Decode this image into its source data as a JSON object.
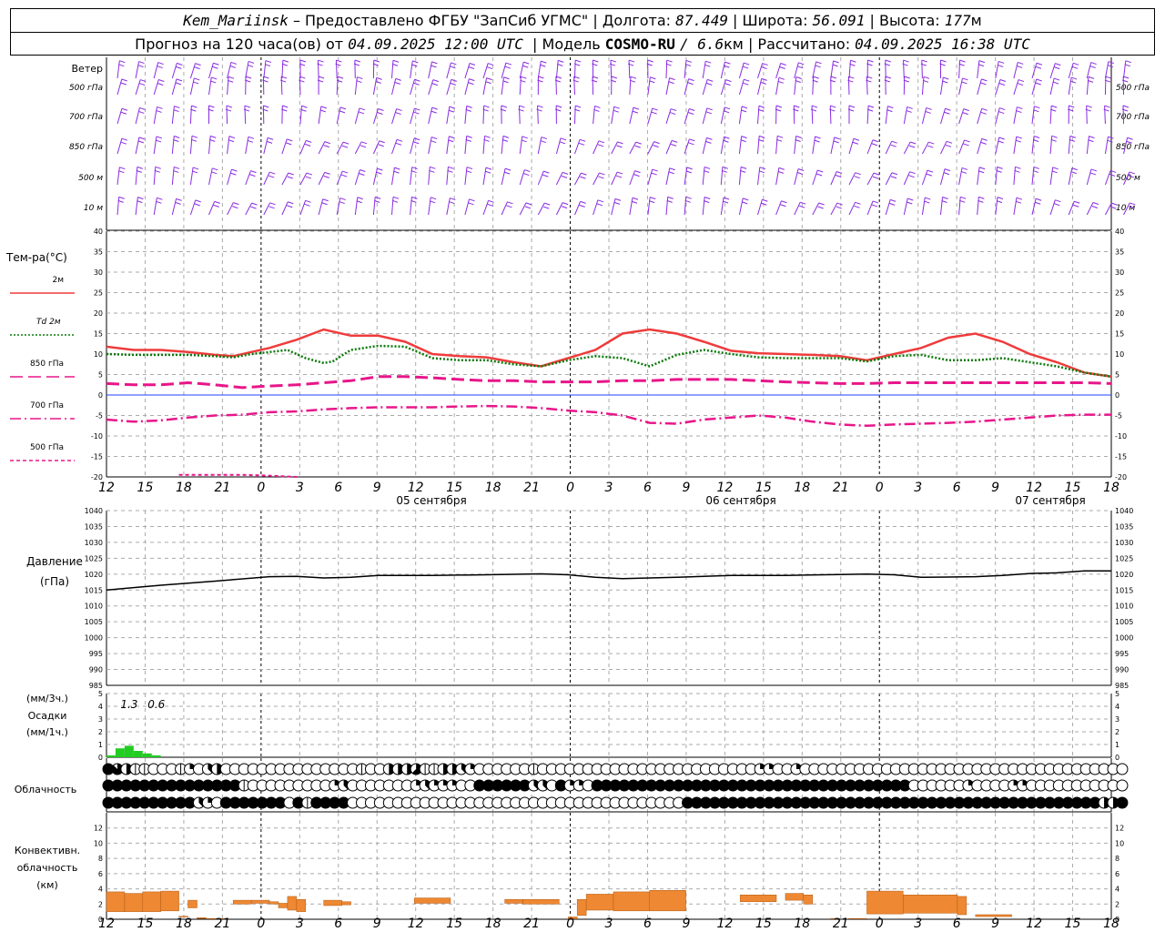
{
  "header": {
    "station": "Kem_Mariinsk",
    "provider": "– Предоставлено ФГБУ \"ЗапСиб УГМС\"",
    "lon_label": "| Долгота:",
    "lon": "87.449",
    "lat_label": "| Широта:",
    "lat": "56.091",
    "alt_label": "| Высота:",
    "alt": "177",
    "alt_unit": "м",
    "forecast_label": "Прогноз на 120 часа(ов) от",
    "forecast_start": "04.09.2025 12:00 UTC",
    "model_label": "| Модель",
    "model": "COSMO-RU",
    "model_res": "/ 6.6",
    "model_res_unit": "км",
    "calc_label": "| Рассчитано:",
    "calc_time": "04.09.2025 16:38 UTC"
  },
  "axis": {
    "hour_ticks": [
      "12",
      "15",
      "18",
      "21",
      "0",
      "3",
      "6",
      "9",
      "12",
      "15",
      "18",
      "21",
      "0",
      "3",
      "6",
      "9",
      "12",
      "15",
      "18",
      "21",
      "0",
      "3",
      "6",
      "9",
      "12",
      "15",
      "18"
    ],
    "day_labels": [
      "05 сентября",
      "06 сентября",
      "07 сентября"
    ]
  },
  "wind": {
    "title": "Ветер",
    "levels": [
      "500 гПа",
      "700 гПа",
      "850 гПа",
      "500 м",
      "10  м"
    ],
    "color": "#8a2be2"
  },
  "chart_data": [
    {
      "type": "line",
      "panel": "temperature",
      "title": "Тем-ра(°C)",
      "ylim": [
        -20,
        40
      ],
      "ticks": [
        -20,
        -15,
        -10,
        -5,
        0,
        5,
        10,
        15,
        20,
        25,
        30,
        35,
        40
      ],
      "series": [
        {
          "name": "2м",
          "color": "#ef3b3b",
          "style": "solid",
          "points": [
            [
              0,
              11.8
            ],
            [
              3,
              11
            ],
            [
              6,
              11
            ],
            [
              9,
              10.5
            ],
            [
              12,
              9.8
            ],
            [
              14,
              9.5
            ],
            [
              16,
              10.5
            ],
            [
              18,
              11.5
            ],
            [
              21,
              13.5
            ],
            [
              24,
              16
            ],
            [
              27,
              14.5
            ],
            [
              30,
              14.5
            ],
            [
              33,
              13
            ],
            [
              36,
              10
            ],
            [
              39,
              9.5
            ],
            [
              42,
              9.2
            ],
            [
              45,
              8
            ],
            [
              48,
              7
            ],
            [
              51,
              9
            ],
            [
              54,
              11
            ],
            [
              57,
              15
            ],
            [
              60,
              16
            ],
            [
              63,
              15
            ],
            [
              66,
              13
            ],
            [
              69,
              10.8
            ],
            [
              72,
              10.2
            ],
            [
              75,
              10
            ],
            [
              78,
              9.8
            ],
            [
              81,
              9.5
            ],
            [
              84,
              8.5
            ],
            [
              87,
              10
            ],
            [
              90,
              11.5
            ],
            [
              93,
              14
            ],
            [
              96,
              15
            ],
            [
              99,
              13
            ],
            [
              102,
              10
            ],
            [
              105,
              8
            ],
            [
              108,
              5.5
            ],
            [
              111,
              4.5
            ]
          ]
        },
        {
          "name": "Td  2м",
          "color": "#0a7a0a",
          "style": "dotted",
          "points": [
            [
              0,
              10
            ],
            [
              3,
              9.8
            ],
            [
              6,
              9.8
            ],
            [
              9,
              9.8
            ],
            [
              12,
              9.5
            ],
            [
              14,
              9.2
            ],
            [
              16,
              10
            ],
            [
              18,
              10.5
            ],
            [
              20,
              11
            ],
            [
              22,
              9
            ],
            [
              24,
              7.8
            ],
            [
              25,
              8.2
            ],
            [
              27,
              11
            ],
            [
              30,
              12
            ],
            [
              33,
              11.8
            ],
            [
              36,
              9
            ],
            [
              39,
              8.5
            ],
            [
              42,
              8.5
            ],
            [
              45,
              7.5
            ],
            [
              48,
              7
            ],
            [
              51,
              8.5
            ],
            [
              54,
              9.5
            ],
            [
              57,
              9
            ],
            [
              60,
              7
            ],
            [
              63,
              9.8
            ],
            [
              66,
              11
            ],
            [
              69,
              10
            ],
            [
              72,
              9.2
            ],
            [
              75,
              9
            ],
            [
              78,
              9
            ],
            [
              81,
              9
            ],
            [
              84,
              8.2
            ],
            [
              87,
              9.5
            ],
            [
              90,
              9.8
            ],
            [
              93,
              8.5
            ],
            [
              96,
              8.5
            ],
            [
              99,
              9
            ],
            [
              102,
              8
            ],
            [
              105,
              7
            ],
            [
              108,
              5.5
            ],
            [
              111,
              4.5
            ]
          ]
        },
        {
          "name": "850 гПа",
          "color": "#e8168a",
          "style": "longdash",
          "points": [
            [
              0,
              2.8
            ],
            [
              3,
              2.5
            ],
            [
              6,
              2.5
            ],
            [
              9,
              3
            ],
            [
              12,
              2.5
            ],
            [
              15,
              1.8
            ],
            [
              18,
              2.2
            ],
            [
              21,
              2.5
            ],
            [
              24,
              3
            ],
            [
              27,
              3.5
            ],
            [
              30,
              4.5
            ],
            [
              33,
              4.5
            ],
            [
              36,
              4.2
            ],
            [
              39,
              3.8
            ],
            [
              42,
              3.5
            ],
            [
              45,
              3.5
            ],
            [
              48,
              3.2
            ],
            [
              51,
              3.2
            ],
            [
              54,
              3.2
            ],
            [
              57,
              3.5
            ],
            [
              60,
              3.5
            ],
            [
              63,
              3.8
            ],
            [
              66,
              3.8
            ],
            [
              69,
              3.8
            ],
            [
              72,
              3.5
            ],
            [
              75,
              3.2
            ],
            [
              78,
              3
            ],
            [
              81,
              2.8
            ],
            [
              84,
              2.8
            ],
            [
              87,
              3
            ],
            [
              90,
              3
            ],
            [
              93,
              3
            ],
            [
              96,
              3
            ],
            [
              99,
              3
            ],
            [
              102,
              3
            ],
            [
              105,
              3
            ],
            [
              108,
              3
            ],
            [
              111,
              2.8
            ]
          ]
        },
        {
          "name": "700 гПа",
          "color": "#e8168a",
          "style": "dashdot",
          "points": [
            [
              0,
              -6
            ],
            [
              3,
              -6.5
            ],
            [
              6,
              -6.2
            ],
            [
              9,
              -5.5
            ],
            [
              12,
              -5
            ],
            [
              15,
              -4.8
            ],
            [
              18,
              -4.2
            ],
            [
              21,
              -4
            ],
            [
              24,
              -3.5
            ],
            [
              27,
              -3.2
            ],
            [
              30,
              -3
            ],
            [
              33,
              -3
            ],
            [
              36,
              -3
            ],
            [
              39,
              -2.8
            ],
            [
              42,
              -2.7
            ],
            [
              45,
              -2.8
            ],
            [
              48,
              -3.2
            ],
            [
              51,
              -3.8
            ],
            [
              54,
              -4.2
            ],
            [
              57,
              -5
            ],
            [
              60,
              -6.8
            ],
            [
              63,
              -7
            ],
            [
              66,
              -6
            ],
            [
              69,
              -5.5
            ],
            [
              72,
              -5
            ],
            [
              75,
              -5.5
            ],
            [
              78,
              -6.5
            ],
            [
              81,
              -7.2
            ],
            [
              84,
              -7.5
            ],
            [
              87,
              -7.2
            ],
            [
              90,
              -7
            ],
            [
              93,
              -6.8
            ],
            [
              96,
              -6.5
            ],
            [
              99,
              -6
            ],
            [
              102,
              -5.5
            ],
            [
              105,
              -5
            ],
            [
              108,
              -4.8
            ],
            [
              111,
              -4.8
            ]
          ]
        },
        {
          "name": "500 гПа",
          "color": "#e8168a",
          "style": "dashed",
          "points": [
            [
              8,
              -19.5
            ],
            [
              12,
              -19.5
            ],
            [
              15,
              -19.5
            ],
            [
              18,
              -19.7
            ],
            [
              21,
              -20
            ]
          ]
        }
      ]
    },
    {
      "type": "line",
      "panel": "pressure",
      "title": "Давление",
      "ylabel": "(гПа)",
      "ylim": [
        985,
        1040
      ],
      "ticks": [
        985,
        990,
        995,
        1000,
        1005,
        1010,
        1015,
        1020,
        1025,
        1030,
        1035,
        1040
      ],
      "series": [
        {
          "name": "",
          "color": "#000000",
          "points": [
            [
              0,
              1015
            ],
            [
              6,
              1016.5
            ],
            [
              12,
              1017.8
            ],
            [
              18,
              1019.2
            ],
            [
              21,
              1019.3
            ],
            [
              24,
              1018.8
            ],
            [
              27,
              1019
            ],
            [
              30,
              1019.6
            ],
            [
              36,
              1019.6
            ],
            [
              42,
              1019.8
            ],
            [
              48,
              1020.1
            ],
            [
              51,
              1019.8
            ],
            [
              54,
              1019
            ],
            [
              57,
              1018.6
            ],
            [
              60,
              1018.8
            ],
            [
              63,
              1019
            ],
            [
              69,
              1019.6
            ],
            [
              75,
              1019.6
            ],
            [
              81,
              1019.9
            ],
            [
              84,
              1020
            ],
            [
              87,
              1019.8
            ],
            [
              90,
              1019
            ],
            [
              93,
              1019.1
            ],
            [
              96,
              1019.2
            ],
            [
              99,
              1019.6
            ],
            [
              102,
              1020.2
            ],
            [
              105,
              1020.4
            ],
            [
              108,
              1021
            ],
            [
              111,
              1021
            ]
          ]
        }
      ]
    },
    {
      "type": "bar",
      "panel": "precipitation",
      "title": "Осадки",
      "ylabel_top": "(мм/3ч.)",
      "ylabel_bottom": "(мм/1ч.)",
      "ylim": [
        0,
        5
      ],
      "ticks": [
        0,
        1,
        2,
        3,
        4,
        5
      ],
      "color": "#22cc22",
      "annotations": [
        {
          "x": 1.5,
          "text": "1.3"
        },
        {
          "x": 4.5,
          "text": "0.6"
        }
      ],
      "bars": [
        [
          1,
          0.15
        ],
        [
          2,
          0.7
        ],
        [
          3,
          0.9
        ],
        [
          4,
          0.5
        ],
        [
          5,
          0.3
        ],
        [
          6,
          0.15
        ]
      ]
    },
    {
      "type": "bar",
      "panel": "convective_cloud",
      "title": "Конвективн.",
      "ylabel": "облачность",
      "ylabel2": "(км)",
      "ylim": [
        0,
        14
      ],
      "ticks": [
        0,
        2,
        4,
        6,
        8,
        10,
        12
      ],
      "color": "#ee8833",
      "bars": [
        [
          0,
          2,
          1,
          3.6
        ],
        [
          2,
          4,
          1,
          3.4
        ],
        [
          4,
          6,
          1,
          3.6
        ],
        [
          6,
          8,
          1.1,
          3.7
        ],
        [
          8,
          9,
          0.3,
          0.4
        ],
        [
          9,
          10,
          1.5,
          2.5
        ],
        [
          10,
          11,
          0.1,
          0.2
        ],
        [
          11,
          13,
          0.05,
          0.1
        ],
        [
          14,
          16,
          2,
          2.5
        ],
        [
          16,
          18,
          2.1,
          2.5
        ],
        [
          18,
          19,
          2,
          2.3
        ],
        [
          19,
          20,
          1.5,
          2.1
        ],
        [
          20,
          21,
          1.2,
          3
        ],
        [
          21,
          22,
          1,
          2.6
        ],
        [
          24,
          26,
          1.8,
          2.5
        ],
        [
          26,
          27,
          1.9,
          2.3
        ],
        [
          34,
          38,
          2.1,
          2.8
        ],
        [
          44,
          46,
          2.1,
          2.6
        ],
        [
          46,
          50,
          2,
          2.6
        ],
        [
          51,
          52,
          0.05,
          0.3
        ],
        [
          52,
          53,
          0.5,
          2.6
        ],
        [
          53,
          56,
          1.2,
          3.3
        ],
        [
          56,
          60,
          1.1,
          3.6
        ],
        [
          60,
          64,
          1.1,
          3.8
        ],
        [
          70,
          74,
          2.3,
          3.2
        ],
        [
          75,
          77,
          2.5,
          3.4
        ],
        [
          77,
          78,
          2,
          3.2
        ],
        [
          80,
          81,
          0.05,
          0.1
        ],
        [
          82,
          84,
          0.05,
          0.1
        ],
        [
          84,
          88,
          0.7,
          3.7
        ],
        [
          88,
          94,
          0.8,
          3.2
        ],
        [
          94,
          95,
          0.6,
          3
        ],
        [
          96,
          100,
          0.35,
          0.6
        ]
      ]
    }
  ],
  "clouds": {
    "title": "Облачность",
    "rows": [
      "87411000120340000000000000001004445114432000000100000000000000000000000022002000000000000000000000000000000000000",
      "88888888888888810000000002300000002322200888888330822088888888888888888888888888888888888000000200002200000000000",
      "88888888883208888888081888800000000000000000000000000000000000008888888888888888888888888888888888888888888888448"
    ]
  }
}
